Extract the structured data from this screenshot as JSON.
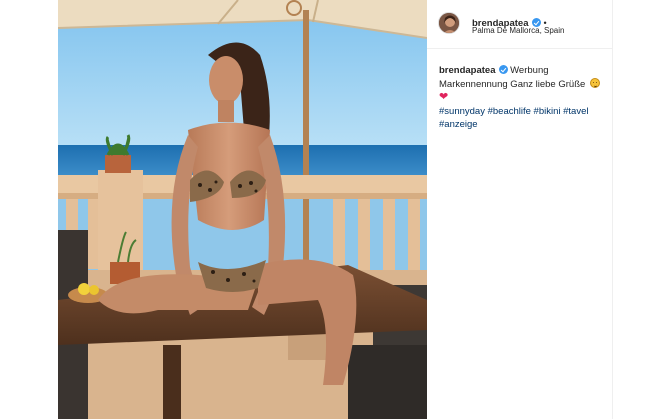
{
  "post": {
    "username": "brendapatea",
    "location": "Palma De Mallorca, Spain",
    "header_separator": "•",
    "verified": true,
    "caption": {
      "username": "brendapatea",
      "text": "Werbung Markennennung Ganz liebe Grüße",
      "emoji_icons": [
        "smiling-face-emoji-icon",
        "red-heart-emoji-icon"
      ],
      "heart_glyph": "❤",
      "hashtags": [
        "#sunnyday",
        "#beachlife",
        "#bikini",
        "#tavel",
        "#anzeige"
      ]
    },
    "image": {
      "description_icon": "photo-woman-bikini-terrace-icon"
    }
  },
  "colors": {
    "verified_badge": "#3897f0",
    "hashtag": "#003569",
    "text": "#262626",
    "border": "#efefef"
  }
}
